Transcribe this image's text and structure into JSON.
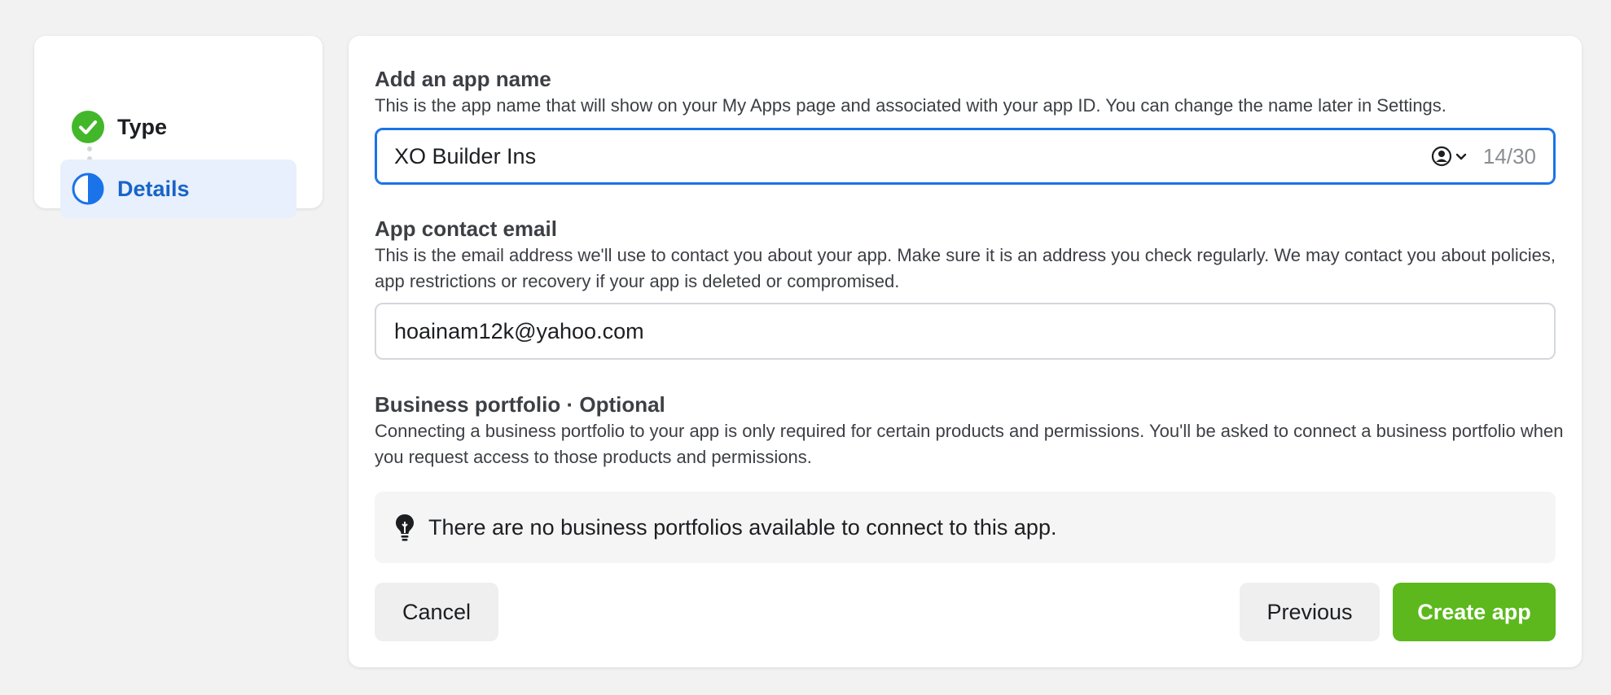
{
  "stepper": {
    "steps": [
      {
        "label": "Type",
        "state": "complete"
      },
      {
        "label": "Details",
        "state": "current"
      }
    ]
  },
  "app_name": {
    "title": "Add an app name",
    "description": "This is the app name that will show on your My Apps page and associated with your app ID. You can change the name later in Settings.",
    "value": "XO Builder Ins",
    "counter": "14/30"
  },
  "contact_email": {
    "title": "App contact email",
    "description": "This is the email address we'll use to contact you about your app. Make sure it is an address you check regularly. We may contact you about policies, app restrictions or recovery if your app is deleted or compromised.",
    "value": "hoainam12k@yahoo.com"
  },
  "business_portfolio": {
    "title": "Business portfolio · Optional",
    "description": "Connecting a business portfolio to your app is only required for certain products and permissions. You'll be asked to connect a business portfolio when you request access to those products and permissions.",
    "notice": "There are no business portfolios available to connect to this app."
  },
  "actions": {
    "cancel": "Cancel",
    "previous": "Previous",
    "create": "Create app"
  },
  "colors": {
    "accent_blue": "#1a73e8",
    "create_green": "#5cb81c",
    "check_green": "#42b72a"
  }
}
